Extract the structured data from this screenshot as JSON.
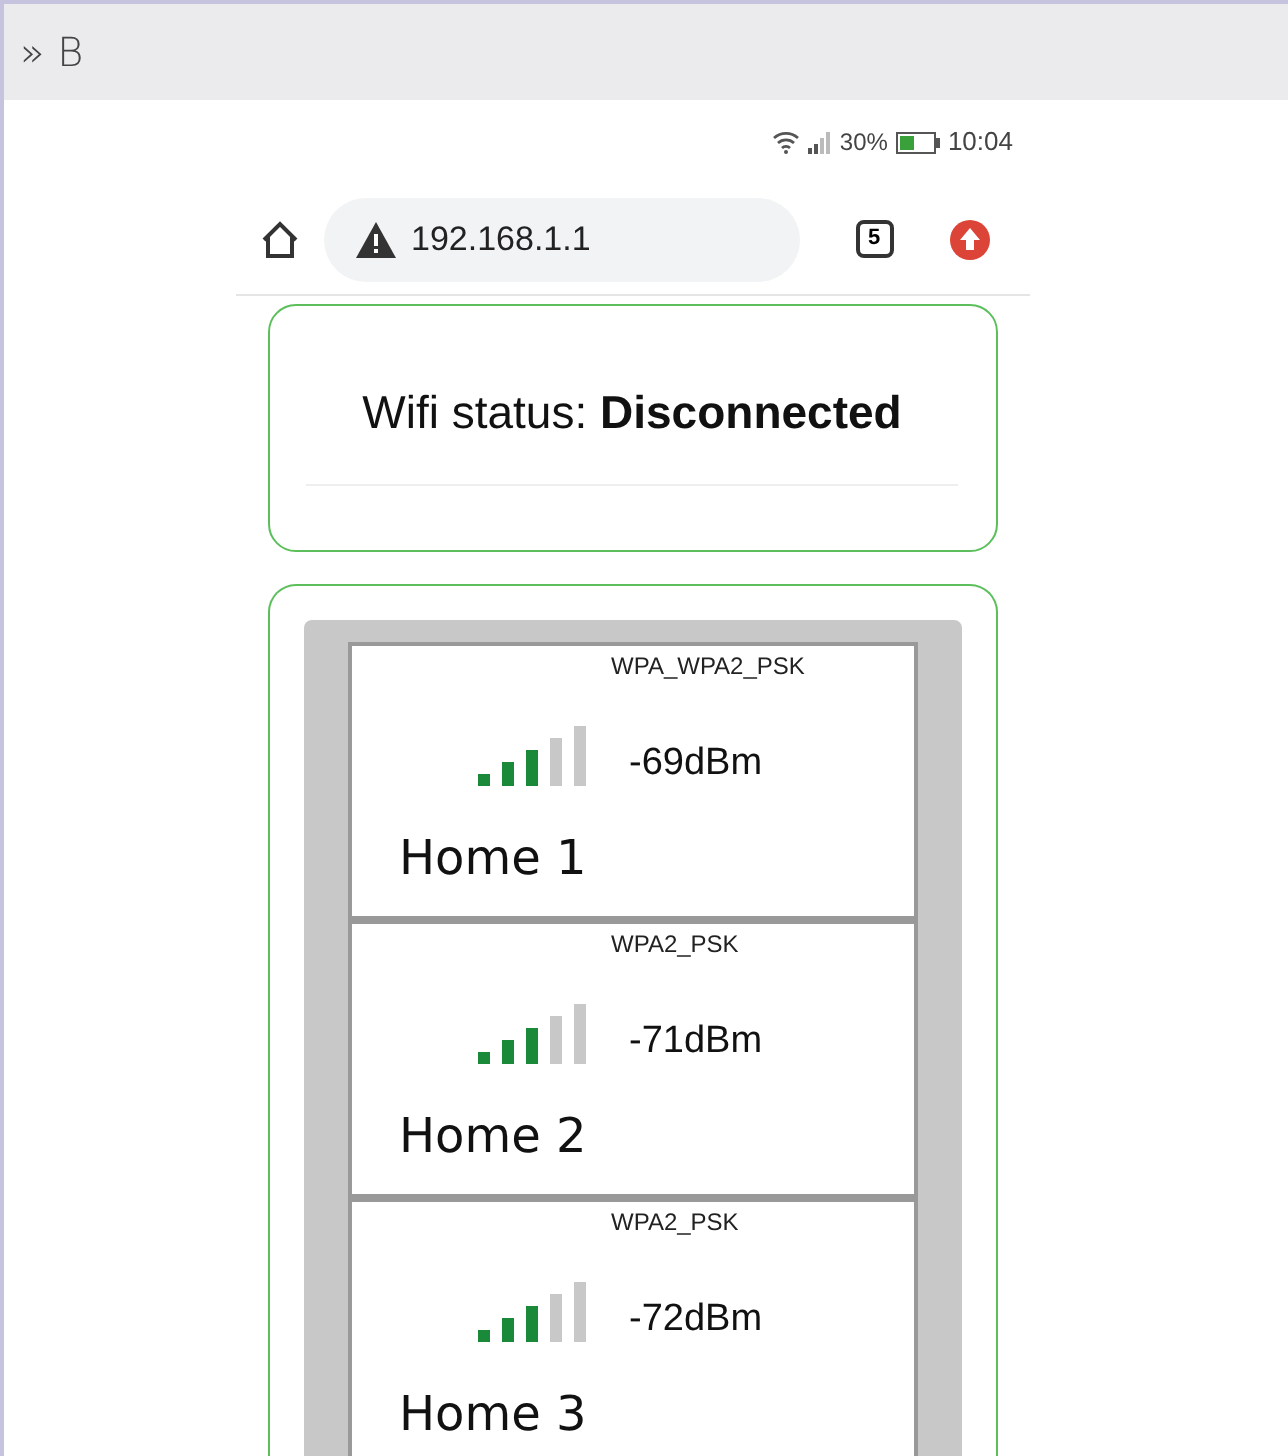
{
  "window": {
    "title": "» B"
  },
  "status_bar": {
    "battery": "30%",
    "time": "10:04"
  },
  "browser": {
    "url": "192.168.1.1",
    "tab_count": "5"
  },
  "wifi_status": "Wifi status: **Disconnected**",
  "networks": [
    {
      "security": "WPA_WPA2_PSK",
      "level": 0.6,
      "signal": "-69dBm",
      "ssid": "Home 1"
    },
    {
      "security": "WPA2_PSK",
      "level": 0.6,
      "signal": "-71dBm",
      "ssid": "Home 2"
    },
    {
      "security": "WPA2_PSK",
      "level": 0.6,
      "signal": "-72dBm",
      "ssid": "Home 3"
    }
  ]
}
